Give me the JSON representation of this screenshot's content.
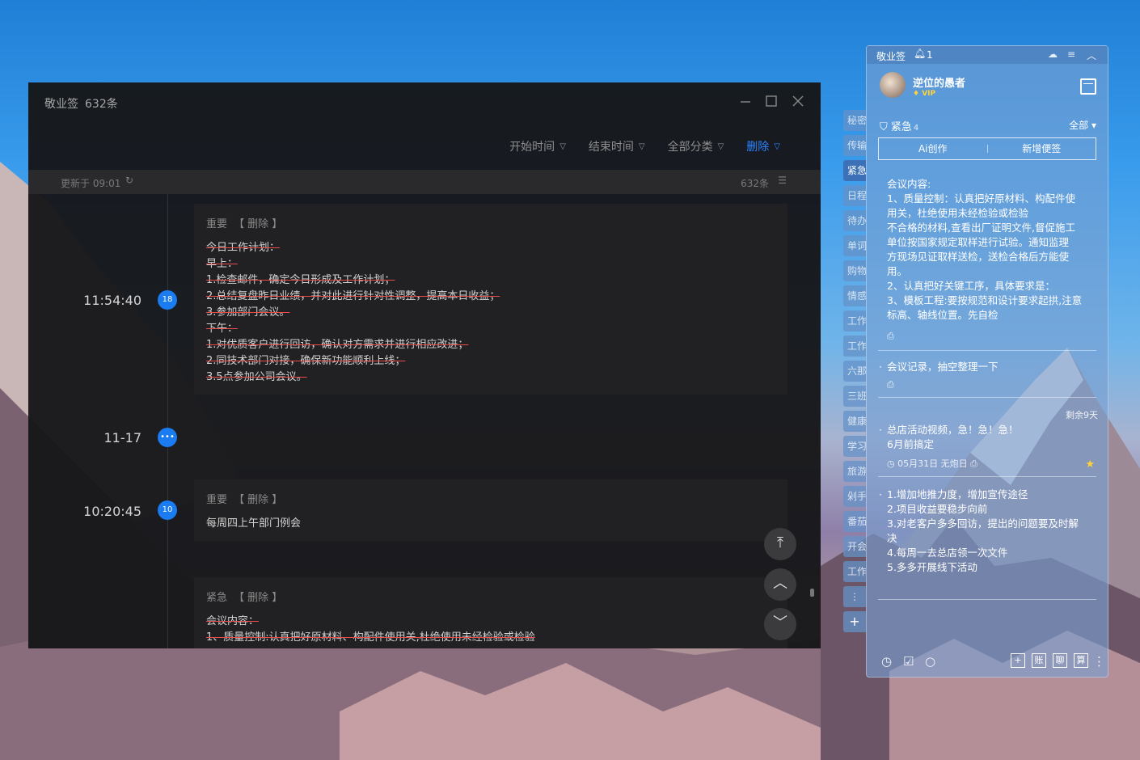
{
  "main_window": {
    "title": "敬业签",
    "count": "632条",
    "toolbar": {
      "start_time": "开始时间",
      "end_time": "结束时间",
      "all_category": "全部分类",
      "delete": "删除"
    },
    "updated": "更新于 09:01",
    "total": "632条",
    "timeline": [
      {
        "time": "11:54:40",
        "badge": "18"
      },
      {
        "time": "11-17",
        "badge": "•••"
      },
      {
        "time": "10:20:45",
        "badge": "10"
      }
    ],
    "cards": [
      {
        "tag": "重要",
        "action": "删除",
        "lines": [
          "今日工作计划：",
          "早上：",
          "1.检查邮件，确定今日形成及工作计划；",
          "2.总结复盘昨日业绩，并对此进行针对性调整，提高本日收益；",
          "3.参加部门会议。",
          "下午：",
          "1.对优质客户进行回访，确认对方需求并进行相应改进；",
          "2.同技术部门对接，确保新功能顺利上线；",
          "3.5点参加公司会议。"
        ]
      },
      {
        "tag": "重要",
        "action": "删除",
        "lines": [
          "每周四上午部门例会"
        ]
      },
      {
        "tag": "紧急",
        "action": "删除",
        "lines": [
          "会议内容：",
          "1、质量控制:认真把好原材料、构配件使用关,杜绝使用未经检验或检验"
        ]
      }
    ]
  },
  "panel": {
    "app_title": "敬业签",
    "notify_count": "1",
    "user_name": "逆位的愚者",
    "vip": "VIP",
    "category": "紧急",
    "category_count": "4",
    "filter": "全部",
    "ai_btn": "Ai创作",
    "new_btn": "新增便签",
    "notes": [
      {
        "lines": [
          "会议内容:",
          "1、质量控制：认真把好原材料、构配件使",
          "用关，杜绝使用未经检验或检验",
          "不合格的材料,查看出厂证明文件,督促施工",
          "单位按国家规定取样进行试验。通知监理",
          "方现场见证取样送检，送检合格后方能使",
          "用。",
          "2、认真把好关键工序，具体要求是：",
          "3、模板工程:要按规范和设计要求起拱,注意",
          "标高、轴线位置。先自检"
        ]
      },
      {
        "lines": [
          "会议记录，抽空整理一下"
        ]
      },
      {
        "remain": "剩余9天",
        "lines": [
          "总店活动视频，急！急！急！",
          "6月前搞定"
        ],
        "meta": "05月31日 无炮日"
      },
      {
        "lines": [
          "1.增加地推力度，增加宣传途径",
          "2.项目收益要稳步向前",
          "3.对老客户多多回访，提出的问题要及时解",
          "决",
          "4.每周一去总店领一次文件",
          "5.多多开展线下活动"
        ]
      }
    ],
    "bottom_boxes": [
      "账",
      "聊",
      "算"
    ],
    "side_tabs": [
      "秘密",
      "传输",
      "紧急",
      "日程",
      "待办",
      "单词",
      "购物",
      "情感",
      "工作",
      "工作",
      "六那",
      "三班",
      "健康",
      "学习",
      "旅游",
      "剁手",
      "番茄",
      "开会",
      "工作"
    ]
  }
}
